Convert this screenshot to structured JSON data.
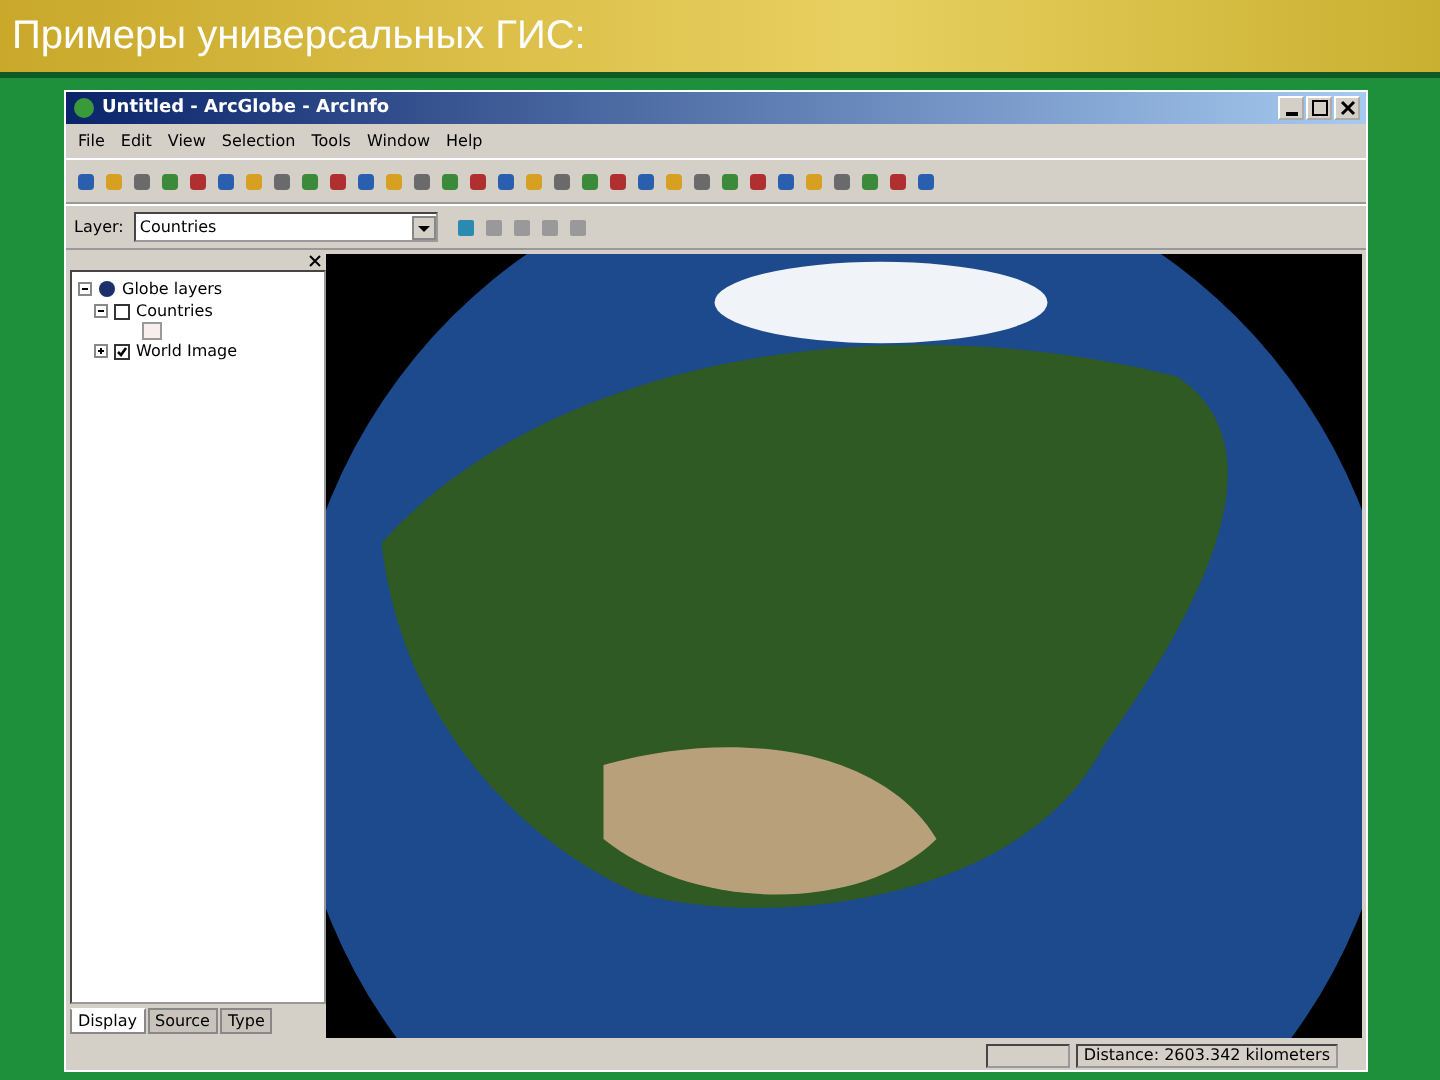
{
  "slide_title": "Примеры универсальных ГИС:",
  "window": {
    "title": "Untitled - ArcGlobe - ArcInfo"
  },
  "menu": [
    "File",
    "Edit",
    "View",
    "Selection",
    "Tools",
    "Window",
    "Help"
  ],
  "layer_selector": {
    "label": "Layer:",
    "value": "Countries"
  },
  "toc": {
    "tree": [
      {
        "label": "Globe layers",
        "expanded": true,
        "children": [
          {
            "label": "Countries",
            "checked": false,
            "expanded": true
          },
          {
            "label": "World Image",
            "checked": true,
            "expanded": false
          }
        ]
      }
    ]
  },
  "tabs": [
    {
      "label": "Display",
      "selected": true
    },
    {
      "label": "Source",
      "selected": false
    },
    {
      "label": "Type",
      "selected": false
    }
  ],
  "status_bar": {
    "distance": "Distance: 2603.342 kilometers"
  }
}
